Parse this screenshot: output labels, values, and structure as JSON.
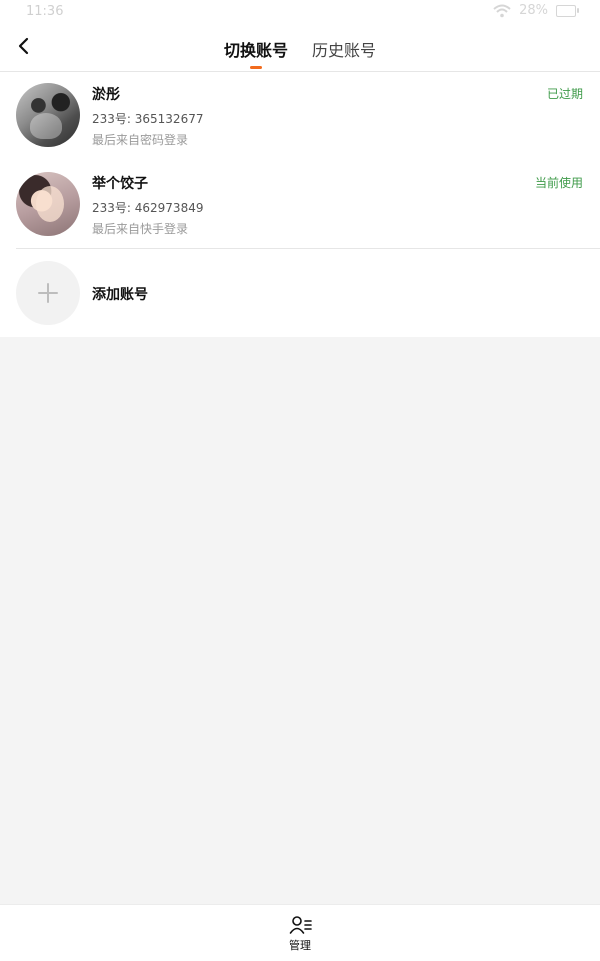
{
  "status_bar": {
    "time": "11:36",
    "battery": "28%"
  },
  "header": {
    "back_icon": "chevron-left-icon",
    "tabs": [
      {
        "label": "切换账号",
        "active": true
      },
      {
        "label": "历史账号",
        "active": false
      }
    ],
    "accent_color": "#f26b1d"
  },
  "accounts": [
    {
      "name": "淤彤",
      "uid": "233号: 365132677",
      "login": "最后来自密码登录",
      "status": "已过期",
      "status_color": "#3f9b4a"
    },
    {
      "name": "举个饺子",
      "uid": "233号: 462973849",
      "login": "最后来自快手登录",
      "status": "当前使用",
      "status_color": "#3f9b4a"
    }
  ],
  "add_account": {
    "label": "添加账号",
    "icon": "plus-icon"
  },
  "bottom_bar": {
    "manage_label": "管理",
    "manage_icon": "user-list-icon"
  }
}
